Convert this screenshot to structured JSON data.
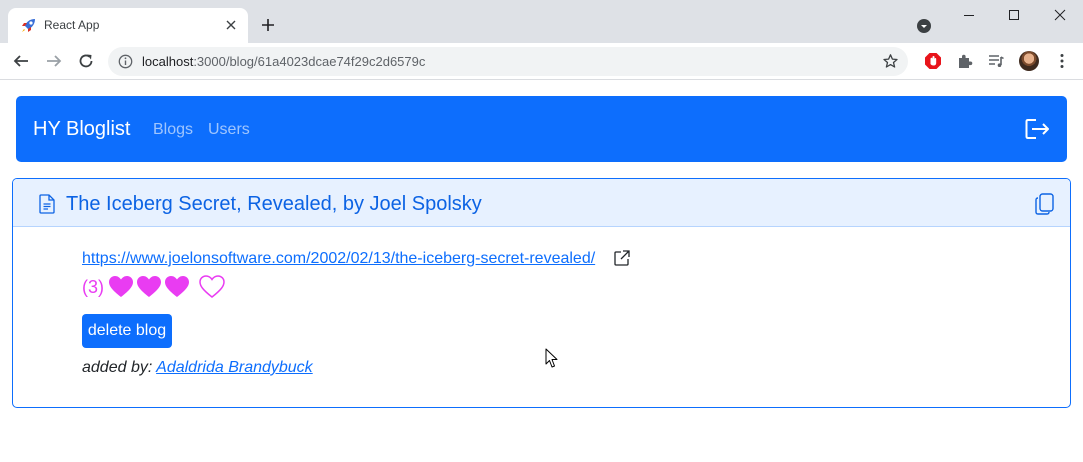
{
  "browser": {
    "tab": {
      "title": "React App",
      "favicon": "rocket-icon"
    },
    "address": {
      "host": "localhost",
      "path": ":3000/blog/61a4023dcae74f29c2d6579c"
    },
    "icons": [
      "back-arrow-icon",
      "forward-arrow-icon",
      "reload-icon",
      "info-icon",
      "bookmark-star-icon",
      "adblock-icon",
      "extensions-puzzle-icon",
      "media-queue-icon",
      "kebab-menu-icon"
    ]
  },
  "navbar": {
    "brand": "HY Bloglist",
    "links": [
      {
        "label": "Blogs"
      },
      {
        "label": "Users"
      }
    ]
  },
  "blog": {
    "title": "The Iceberg Secret, Revealed, by Joel Spolsky",
    "url": "https://www.joelonsoftware.com/2002/02/13/the-iceberg-secret-revealed/",
    "likes_text": "(3)",
    "likes": 3,
    "delete_label": "delete blog",
    "added_by_label": "added by:",
    "added_by_user": "Adaldrida Brandybuck"
  },
  "colors": {
    "primary": "#0d6efd",
    "header_bg": "#e7f1ff",
    "heart": "#e93cf2",
    "tabstrip": "#dee1e6"
  }
}
